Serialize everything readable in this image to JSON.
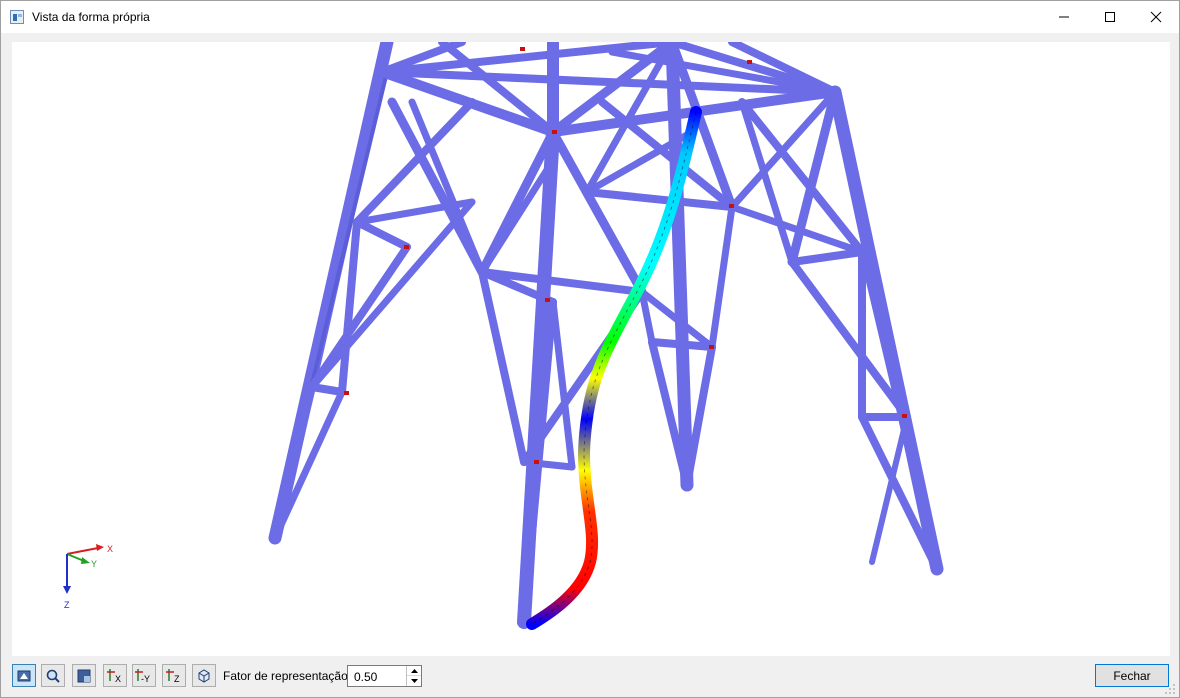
{
  "window": {
    "title": "Vista da forma própria",
    "buttons": {
      "minimize": "—",
      "maximize": "☐",
      "close": "✕"
    }
  },
  "viewport": {
    "axes": {
      "x": "X",
      "y": "Y",
      "z": "Z"
    },
    "colors": {
      "members": "#6b6ce6",
      "members_dark": "#4a4bc9",
      "mode_shape_gradient": [
        "#0000ff",
        "#00ffff",
        "#00ff00",
        "#ffff00",
        "#ff0000"
      ],
      "axis_x": "#d42020",
      "axis_y": "#22a022",
      "axis_z": "#2030c8"
    }
  },
  "toolbar": {
    "buttons": [
      {
        "name": "view-mode-button",
        "icon": "view-mode-icon",
        "label": ""
      },
      {
        "name": "zoom-button",
        "icon": "magnifier-icon",
        "label": ""
      },
      {
        "name": "render-style-button",
        "icon": "render-style-icon",
        "label": ""
      },
      {
        "name": "view-x-button",
        "icon": "view-x-icon",
        "label": "X"
      },
      {
        "name": "view-minus-y-button",
        "icon": "view-minus-y-icon",
        "label": "-Y"
      },
      {
        "name": "view-z-button",
        "icon": "view-z-icon",
        "label": "Z"
      },
      {
        "name": "isometric-button",
        "icon": "isometric-icon",
        "label": ""
      }
    ],
    "factor_label": "Fator de representação:",
    "factor_value": "0.50",
    "close_label": "Fechar"
  }
}
